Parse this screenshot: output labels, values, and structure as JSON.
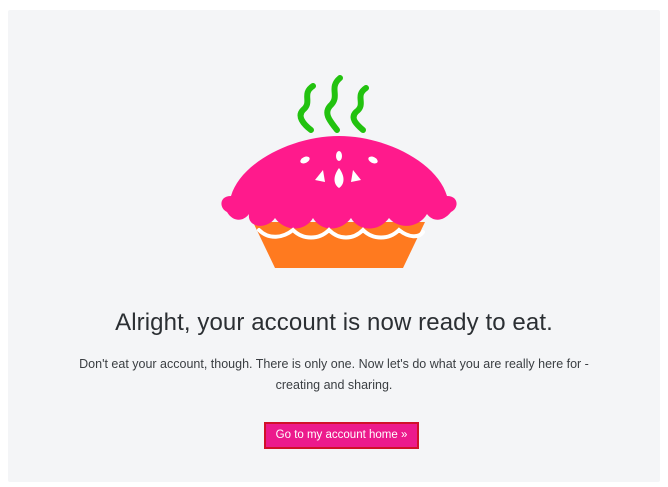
{
  "main": {
    "headline": "Alright, your account is now ready to eat.",
    "subtext": "Don't eat your account, though. There is only one. Now let's do what you are really here for - creating and sharing.",
    "cta_label": "Go to my account home »"
  },
  "illustration": {
    "icon": "pie-icon",
    "steam_color": "#22c20f",
    "crust_color": "#ff1a8c",
    "base_color": "#ff7a1f"
  }
}
